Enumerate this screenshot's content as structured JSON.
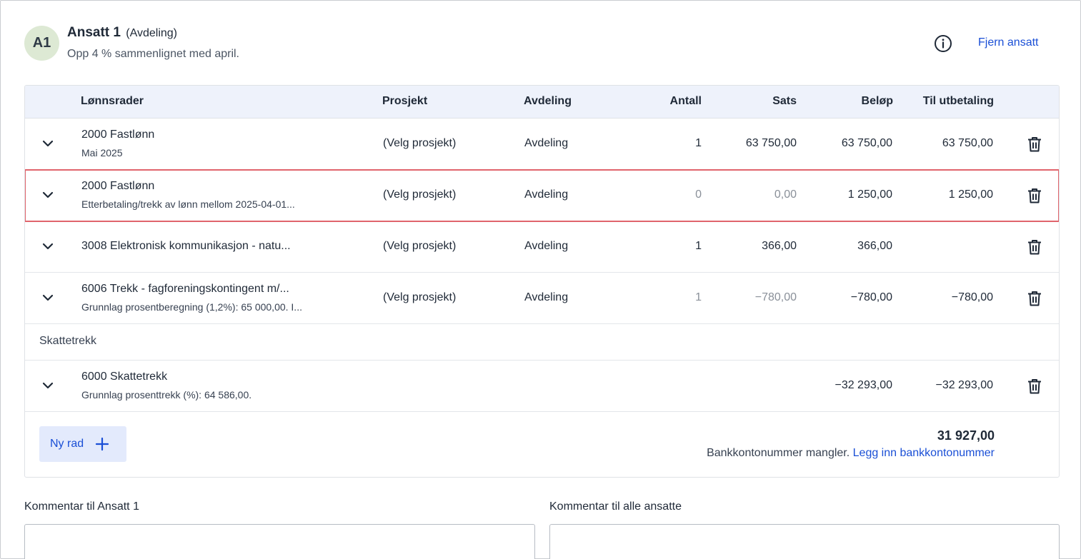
{
  "employee": {
    "initials": "A1",
    "name": "Ansatt 1",
    "department": "(Avdeling)",
    "subtitle": "Opp 4 % sammenlignet med april.",
    "remove_label": "Fjern ansatt"
  },
  "table": {
    "headers": {
      "lonnsrader": "Lønnsrader",
      "prosjekt": "Prosjekt",
      "avdeling": "Avdeling",
      "antall": "Antall",
      "sats": "Sats",
      "belop": "Beløp",
      "til_utbetaling": "Til utbetaling"
    },
    "rows": [
      {
        "title": "2000 Fastlønn",
        "subtitle": "Mai 2025",
        "prosjekt": "(Velg prosjekt)",
        "avdeling": "Avdeling",
        "antall": "1",
        "sats": "63 750,00",
        "belop": "63 750,00",
        "til_utbetaling": "63 750,00"
      },
      {
        "title": "2000 Fastlønn",
        "subtitle": "Etterbetaling/trekk av lønn mellom 2025-04-01...",
        "prosjekt": "(Velg prosjekt)",
        "avdeling": "Avdeling",
        "antall": "0",
        "sats": "0,00",
        "belop": "1 250,00",
        "til_utbetaling": "1 250,00",
        "selected": true
      },
      {
        "title": "3008 Elektronisk kommunikasjon - natu...",
        "subtitle": "",
        "prosjekt": "(Velg prosjekt)",
        "avdeling": "Avdeling",
        "antall": "1",
        "sats": "366,00",
        "belop": "366,00",
        "til_utbetaling": ""
      },
      {
        "title": "6006 Trekk - fagforeningskontingent m/...",
        "subtitle": "Grunnlag prosentberegning (1,2%): 65 000,00. I...",
        "prosjekt": "(Velg prosjekt)",
        "avdeling": "Avdeling",
        "antall": "1",
        "sats": "−780,00",
        "belop": "−780,00",
        "til_utbetaling": "−780,00"
      }
    ],
    "tax_section": {
      "label": "Skattetrekk",
      "row": {
        "title": "6000 Skattetrekk",
        "subtitle": "Grunnlag prosenttrekk (%): 64 586,00.",
        "belop": "−32 293,00",
        "til_utbetaling": "−32 293,00"
      }
    },
    "footer": {
      "add_row_label": "Ny rad",
      "total": "31 927,00",
      "bank_missing": "Bankkontonummer mangler.",
      "bank_link": "Legg inn bankkontonummer"
    }
  },
  "comments": {
    "employee_label": "Kommentar til Ansatt 1",
    "all_label": "Kommentar til alle ansatte"
  },
  "colors": {
    "accent": "#1a4fd6",
    "header_bg": "#eef2fb",
    "avatar_bg": "#dde9d4",
    "selected_outline": "#e0646c",
    "button_bg": "#e3eafc"
  },
  "icons": {
    "info": "info-icon",
    "chevron": "chevron-down-icon",
    "trash": "trash-icon",
    "plus": "plus-icon"
  }
}
